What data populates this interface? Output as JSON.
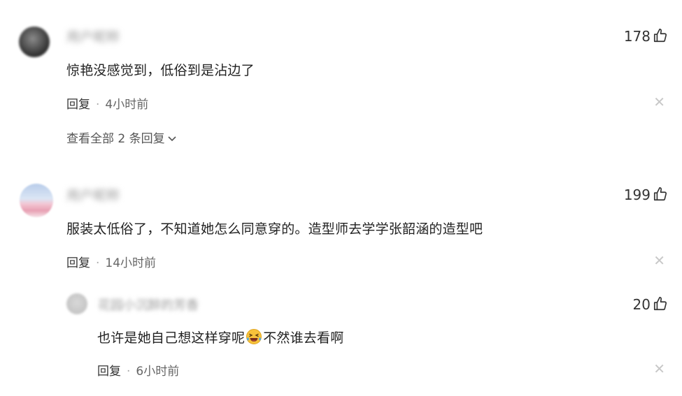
{
  "comments": [
    {
      "username": "用户昵称",
      "text": "惊艳没感觉到，低俗到是沾边了",
      "likes": "178",
      "reply_label": "回复",
      "time": "4小时前",
      "view_replies": "查看全部 2 条回复"
    },
    {
      "username": "用户昵称",
      "text": "服装太低俗了，不知道她怎么同意穿的。造型师去学学张韶涵的造型吧",
      "likes": "199",
      "reply_label": "回复",
      "time": "14小时前"
    }
  ],
  "reply": {
    "username": "花园小沉醉的芳香",
    "text_before": "也许是她自己想这样穿呢",
    "emoji": "laughing-crying-emoji",
    "text_after": "不然谁去看啊",
    "likes": "20",
    "reply_label": "回复",
    "time": "6小时前"
  },
  "icons": {
    "like": "thumbs-up-icon",
    "close": "close-icon",
    "chevron": "chevron-down-icon"
  },
  "colors": {
    "text": "#222222",
    "meta": "#666666",
    "close": "#c8c8c8"
  }
}
